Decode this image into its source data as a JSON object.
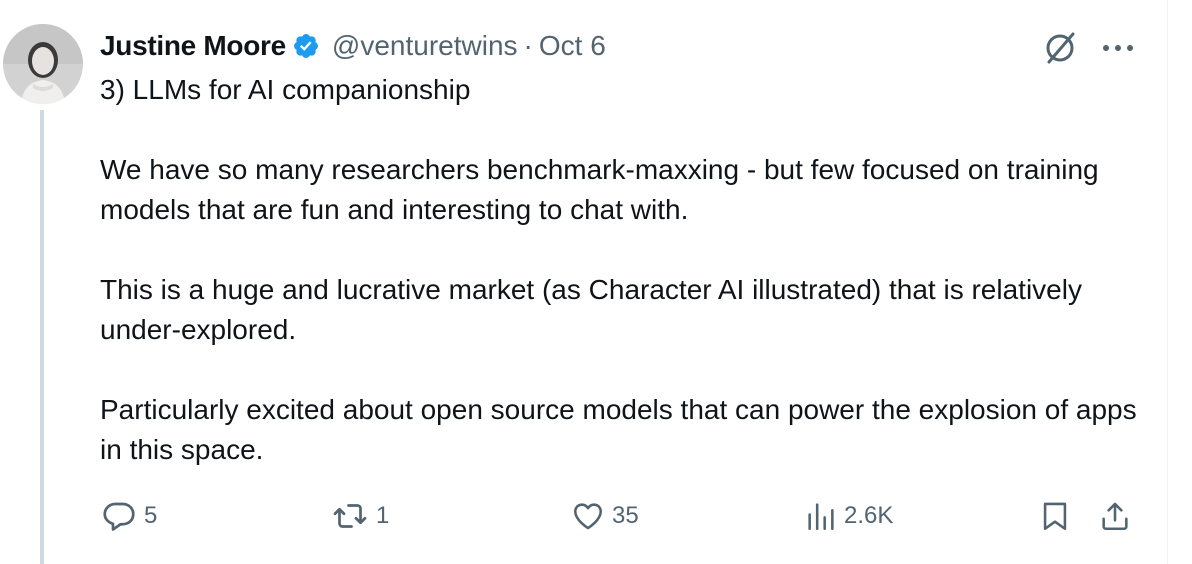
{
  "author": {
    "name": "Justine Moore",
    "handle": "@venturetwins",
    "separator": "·",
    "date": "Oct 6"
  },
  "icons": {
    "verified": "verified-badge-icon",
    "grok": "grok-icon",
    "more": "more-dots-icon",
    "reply": "reply-icon",
    "retweet": "retweet-icon",
    "like": "heart-icon",
    "views": "views-chart-icon",
    "bookmark": "bookmark-icon",
    "share": "share-icon"
  },
  "colors": {
    "verified": "#1d9bf0",
    "text": "#0f1419",
    "secondary": "#536471",
    "thread_line": "#cfd9de"
  },
  "body": {
    "line1": "3) LLMs for AI companionship",
    "para2": "We have so many researchers benchmark-maxxing - but few focused on training models that are fun and interesting to chat with.",
    "para3": "This is a huge and lucrative market (as Character AI illustrated) that is relatively under-explored.",
    "para4": "Particularly excited about open source models that can power the explosion of apps in this space."
  },
  "stats": {
    "replies": "5",
    "retweets": "1",
    "likes": "35",
    "views": "2.6K"
  }
}
